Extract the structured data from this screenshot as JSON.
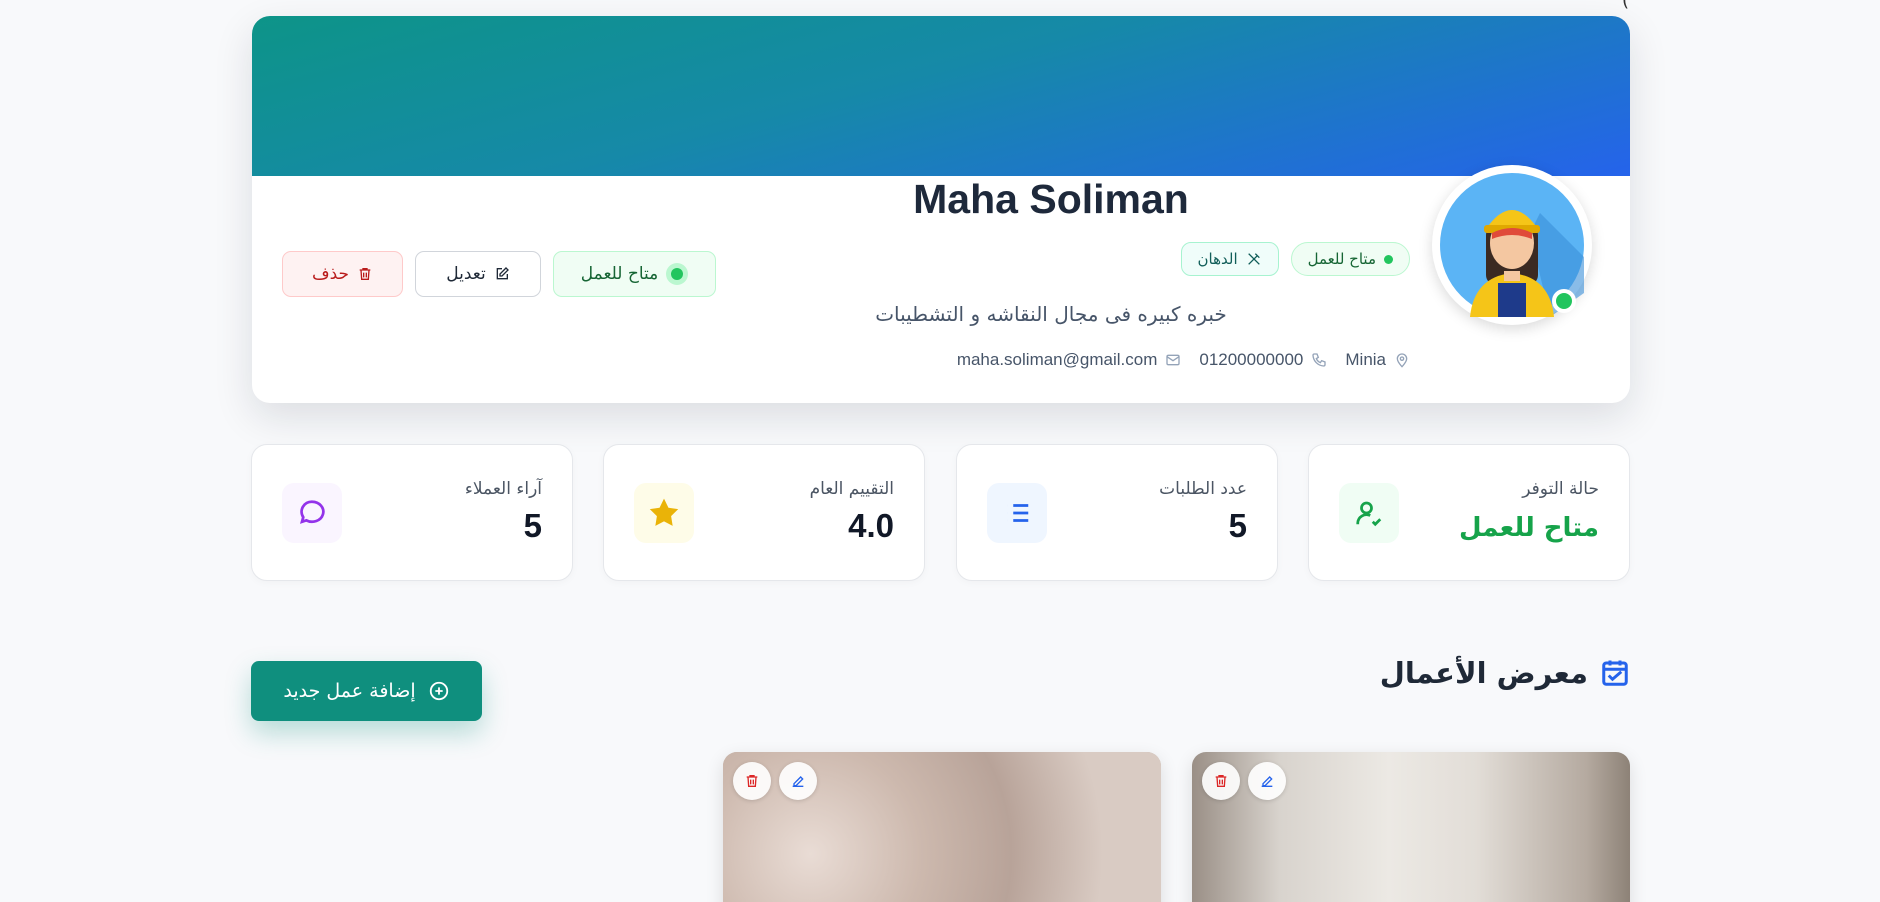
{
  "corner_glyph": "(",
  "profile": {
    "name": "Maha Soliman",
    "status_tag": "متاح للعمل",
    "craft_tag": "الدهان",
    "bio": "خبره كبيره فى مجال النقاشه و التشطيبات",
    "location": "Minia",
    "phone": "01200000000",
    "email": "maha.soliman@gmail.com",
    "buttons": {
      "delete": "حذف",
      "edit": "تعديل",
      "availability": "متاح للعمل"
    },
    "colors": {
      "cover_start": "#0d9488",
      "cover_end": "#2563eb",
      "online": "#22c55e"
    }
  },
  "stats": [
    {
      "label": "حالة التوفر",
      "value": "متاح للعمل",
      "icon": "user-check-icon"
    },
    {
      "label": "عدد الطلبات",
      "value": "5",
      "icon": "list-icon"
    },
    {
      "label": "التقييم العام",
      "value": "4.0",
      "icon": "star-icon"
    },
    {
      "label": "آراء العملاء",
      "value": "5",
      "icon": "message-circle-icon"
    }
  ],
  "gallery": {
    "title": "معرض الأعمال",
    "add_button": "إضافة عمل جديد",
    "items": [
      {
        "icons": [
          "edit-icon",
          "trash-icon"
        ]
      },
      {
        "icons": [
          "edit-icon",
          "trash-icon"
        ]
      }
    ]
  }
}
